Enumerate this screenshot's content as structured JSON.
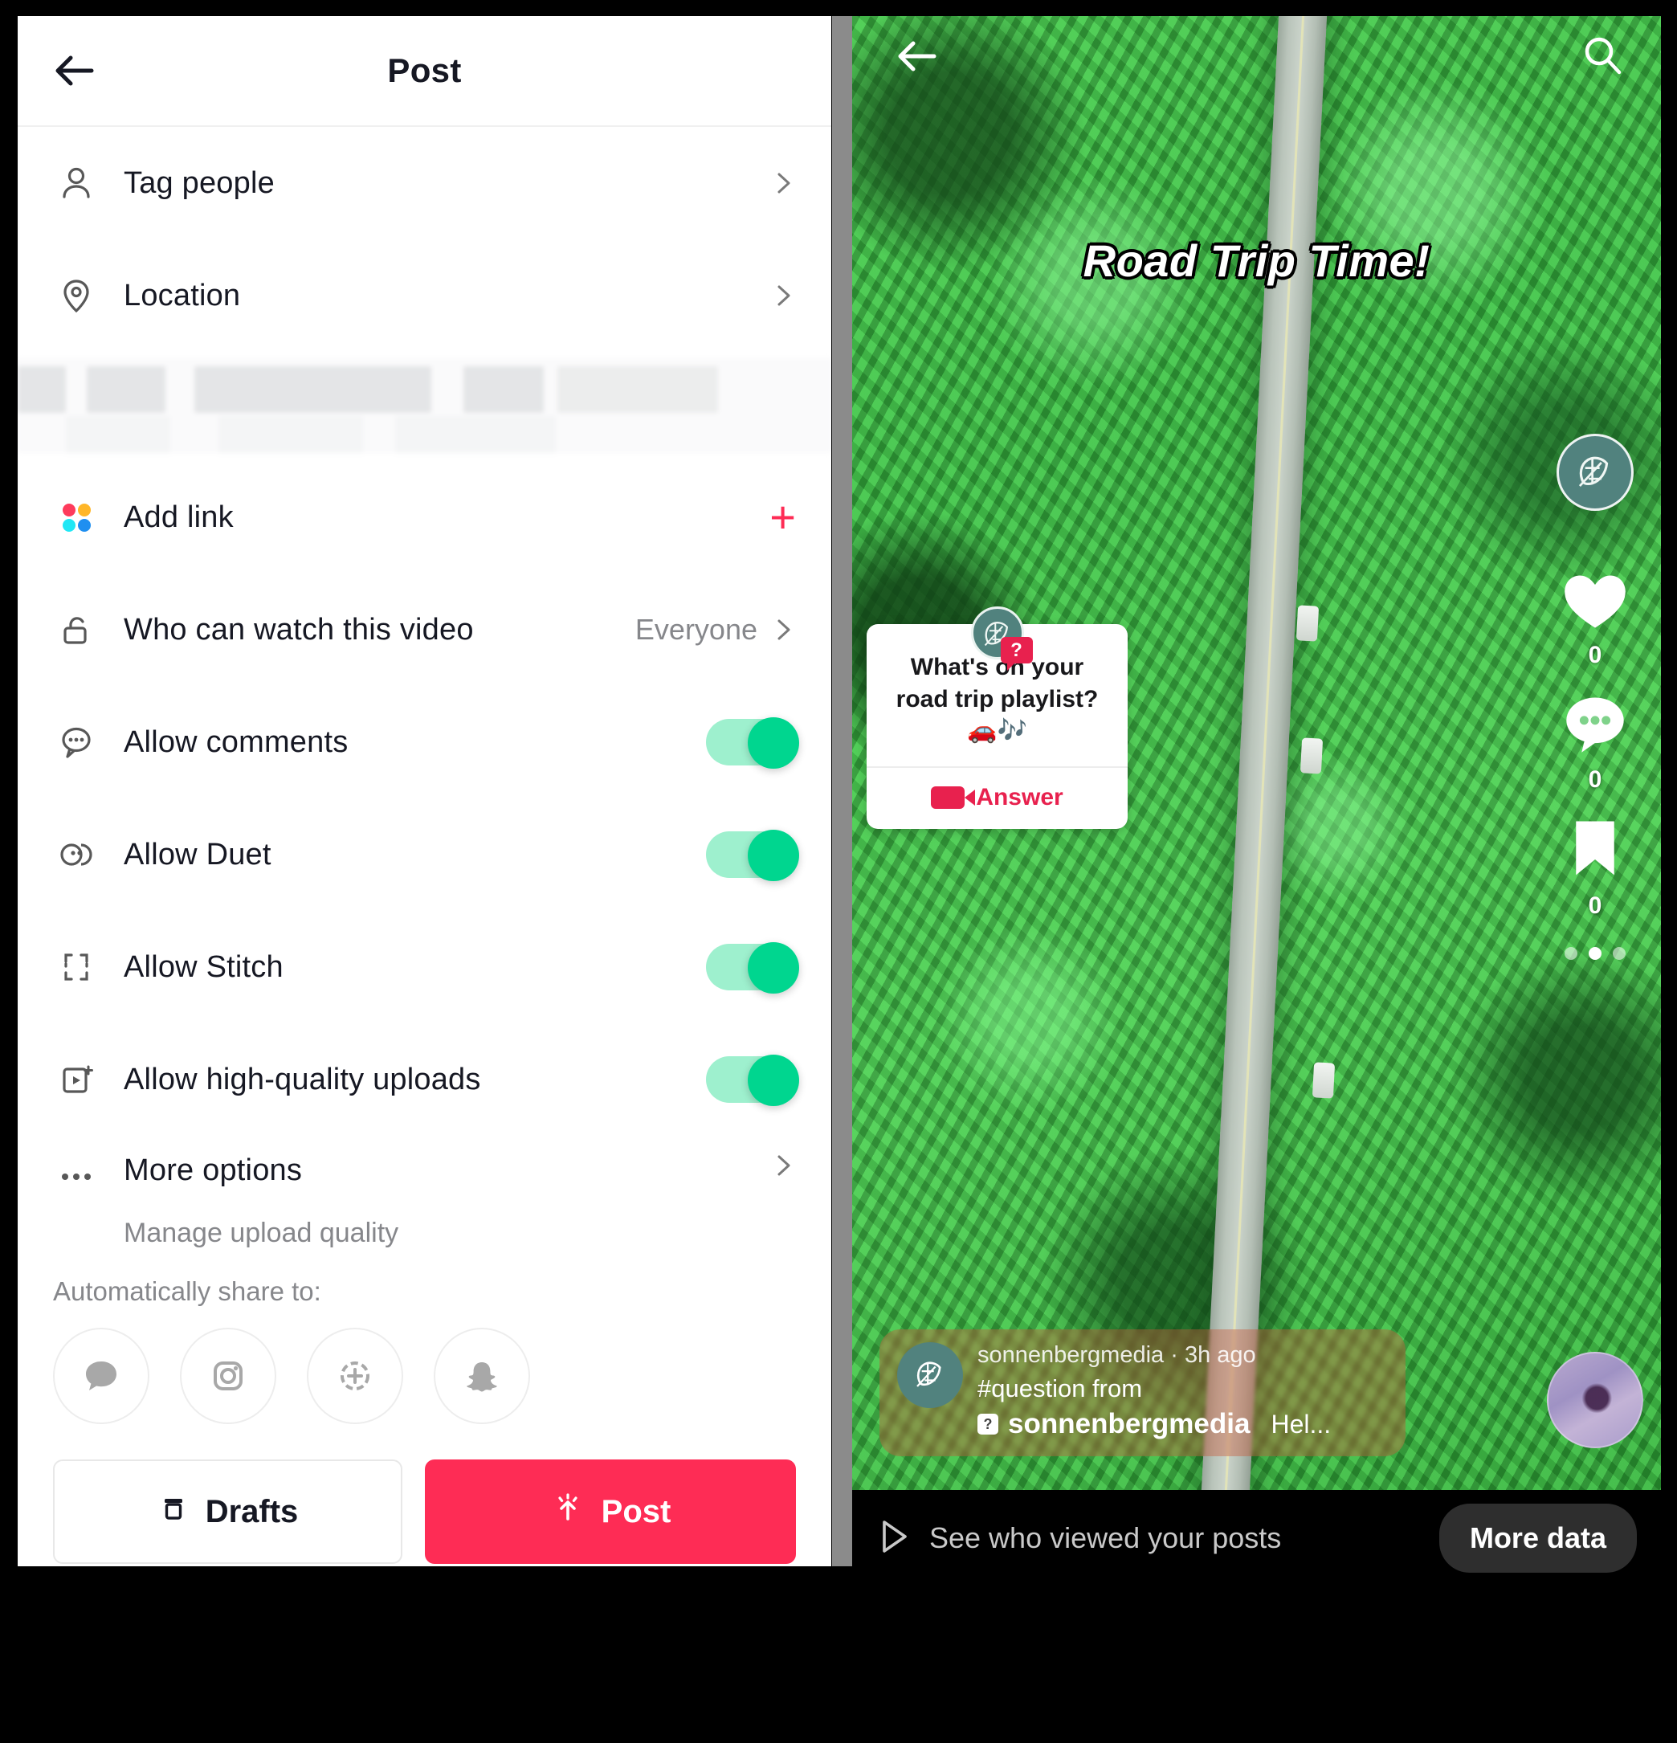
{
  "post_panel": {
    "title": "Post",
    "back_icon": "back-arrow-icon",
    "rows": [
      {
        "label": "Tag people",
        "icon": "person-icon",
        "accessory": "chevron"
      },
      {
        "label": "Location",
        "icon": "location-pin-icon",
        "accessory": "chevron"
      },
      {
        "label": "Add link",
        "icon": "four-dots-icon",
        "accessory": "plus",
        "plus": "+"
      },
      {
        "label": "Who can watch this video",
        "icon": "unlock-icon",
        "accessory": "value",
        "value": "Everyone"
      },
      {
        "label": "Allow comments",
        "icon": "comment-bubble-icon",
        "accessory": "toggle",
        "toggle_on": true
      },
      {
        "label": "Allow Duet",
        "icon": "duet-icon",
        "accessory": "toggle",
        "toggle_on": true
      },
      {
        "label": "Allow Stitch",
        "icon": "stitch-icon",
        "accessory": "toggle",
        "toggle_on": true
      },
      {
        "label": "Allow high-quality uploads",
        "icon": "hq-upload-icon",
        "accessory": "toggle",
        "toggle_on": true
      },
      {
        "label": "More options",
        "icon": "ellipsis-icon",
        "accessory": "chevron",
        "subtitle": "Manage upload quality"
      }
    ],
    "share": {
      "label": "Automatically share to:",
      "targets": [
        {
          "name": "messages-icon"
        },
        {
          "name": "instagram-icon"
        },
        {
          "name": "instagram-story-icon"
        },
        {
          "name": "snapchat-icon"
        }
      ]
    },
    "actions": {
      "drafts_label": "Drafts",
      "drafts_icon": "drafts-box-icon",
      "post_label": "Post",
      "post_icon": "post-upload-icon",
      "post_color": "#FE2C55"
    },
    "toggle_color_on": "#00D68F",
    "toggle_track_color": "#9EF0CE"
  },
  "video_preview": {
    "back_icon": "back-arrow-icon",
    "search_icon": "search-icon",
    "headline": "Road Trip Time!",
    "question_sticker": {
      "avatar_icon": "leaf-logo-icon",
      "badge_icon": "question-mark-icon",
      "badge_text": "?",
      "question": "What's on your road trip playlist? 🚗🎶",
      "answer_label": "Answer",
      "answer_icon": "video-camera-icon",
      "answer_color": "#E8214E"
    },
    "rail": {
      "avatar_icon": "leaf-logo-icon",
      "items": [
        {
          "icon": "heart-icon",
          "count": "0"
        },
        {
          "icon": "comment-icon",
          "count": "0"
        },
        {
          "icon": "bookmark-icon",
          "count": "0"
        }
      ],
      "pagination": {
        "total": 3,
        "active_index": 1
      }
    },
    "caption": {
      "avatar_icon": "leaf-logo-icon",
      "username": "sonnenbergmedia",
      "separator": "·",
      "timestamp": "3h ago",
      "meta_line": "sonnenbergmedia · 3h ago",
      "hashtag": "#question from",
      "from_icon": "question-sticker-icon",
      "from_user": "sonnenbergmedia",
      "trailing_text": "Hel..."
    },
    "profile_thumb_icon": "profile-thumbnail-avatar"
  },
  "bottom_bar": {
    "play_icon": "play-triangle-icon",
    "text": "See who viewed your posts",
    "button_label": "More data"
  }
}
